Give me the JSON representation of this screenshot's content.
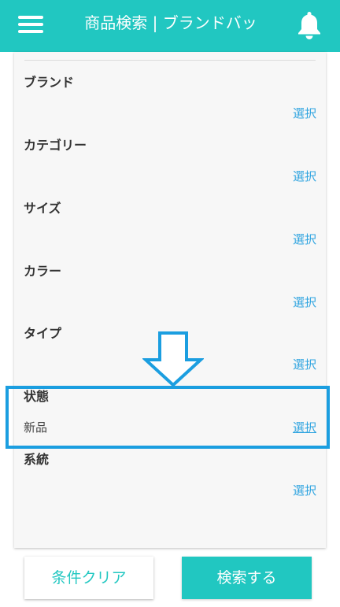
{
  "header": {
    "title": "商品検索 | ブランドバッ",
    "menu_icon": "hamburger-menu-icon",
    "bell_icon": "bell-icon",
    "bg_color": "#21c7c1"
  },
  "filters": [
    {
      "label": "ブランド",
      "value": "",
      "action": "選択"
    },
    {
      "label": "カテゴリー",
      "value": "",
      "action": "選択"
    },
    {
      "label": "サイズ",
      "value": "",
      "action": "選択"
    },
    {
      "label": "カラー",
      "value": "",
      "action": "選択"
    },
    {
      "label": "タイプ",
      "value": "",
      "action": "選択"
    },
    {
      "label": "状態",
      "value": "新品",
      "action": "選択"
    },
    {
      "label": "系統",
      "value": "",
      "action": "選択"
    }
  ],
  "annotation": {
    "arrow_icon": "down-arrow-icon",
    "highlight_color": "#1b9ee0"
  },
  "footer": {
    "clear_label": "条件クリア",
    "search_label": "検索する"
  },
  "colors": {
    "accent": "#21c7c1",
    "link": "#2fa4e0"
  }
}
